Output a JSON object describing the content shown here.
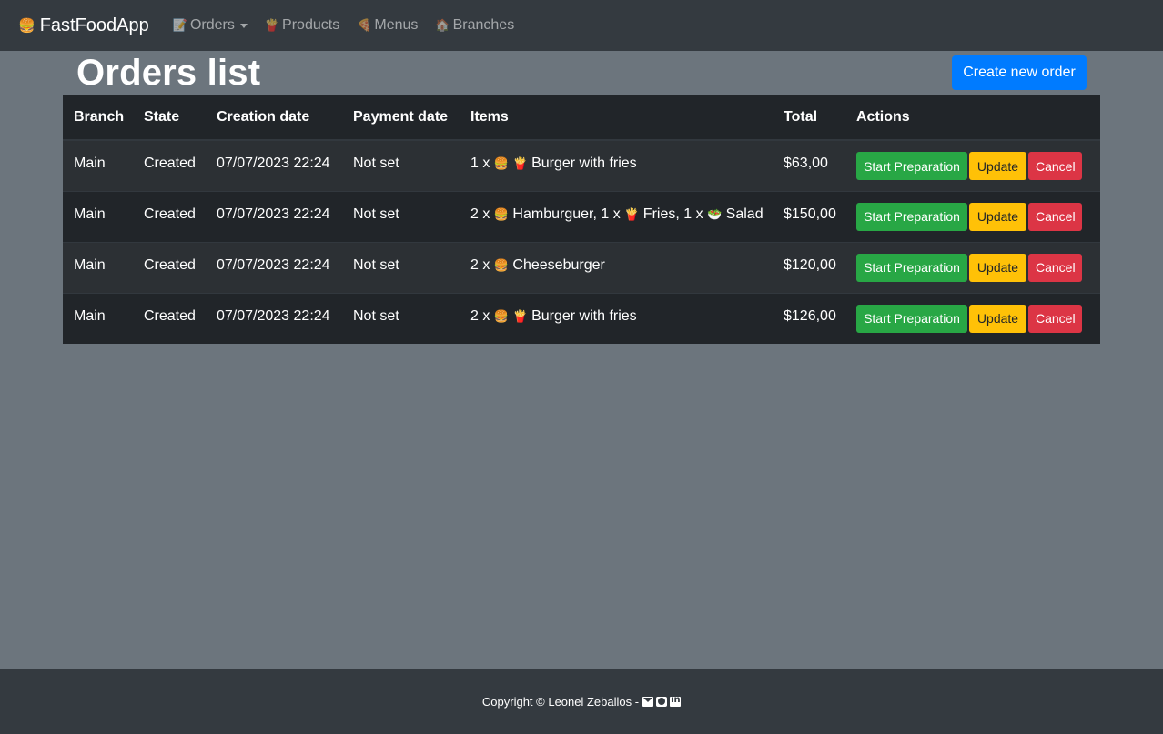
{
  "navbar": {
    "brand": {
      "icon": "🍔",
      "label": "FastFoodApp"
    },
    "items": [
      {
        "icon": "📝",
        "label": "Orders",
        "dropdown": true
      },
      {
        "icon": "🍟",
        "label": "Products",
        "dropdown": false
      },
      {
        "icon": "🍕",
        "label": "Menus",
        "dropdown": false
      },
      {
        "icon": "🏠",
        "label": "Branches",
        "dropdown": false
      }
    ]
  },
  "page": {
    "title": "Orders list",
    "create_button": "Create new order"
  },
  "table": {
    "headers": [
      "Branch",
      "State",
      "Creation date",
      "Payment date",
      "Items",
      "Total",
      "Actions"
    ],
    "rows": [
      {
        "branch": "Main",
        "state": "Created",
        "creation_date": "07/07/2023 22:24",
        "payment_date": "Not set",
        "items": [
          "1 x ",
          "🍔",
          " ",
          "🍟",
          " Burger with fries"
        ],
        "total": "$63,00"
      },
      {
        "branch": "Main",
        "state": "Created",
        "creation_date": "07/07/2023 22:24",
        "payment_date": "Not set",
        "items": [
          "2 x ",
          "🍔",
          " Hamburguer, 1 x ",
          "🍟",
          " Fries, 1 x ",
          "🥗",
          " Salad"
        ],
        "total": "$150,00"
      },
      {
        "branch": "Main",
        "state": "Created",
        "creation_date": "07/07/2023 22:24",
        "payment_date": "Not set",
        "items": [
          "2 x ",
          "🍔",
          " Cheeseburger"
        ],
        "total": "$120,00"
      },
      {
        "branch": "Main",
        "state": "Created",
        "creation_date": "07/07/2023 22:24",
        "payment_date": "Not set",
        "items": [
          "2 x ",
          "🍔",
          " ",
          "🍟",
          " Burger with fries"
        ],
        "total": "$126,00"
      }
    ],
    "actions": {
      "start": "Start Preparation",
      "update": "Update",
      "cancel": "Cancel"
    }
  },
  "footer": {
    "text": "Copyright © Leonel Zeballos - ",
    "icons": [
      "mail-icon",
      "github-icon",
      "linkedin-icon"
    ]
  },
  "colors": {
    "navbar_bg": "#343a40",
    "page_bg": "#6c757d",
    "primary": "#007bff",
    "success": "#28a745",
    "warning": "#ffc107",
    "danger": "#dc3545"
  }
}
